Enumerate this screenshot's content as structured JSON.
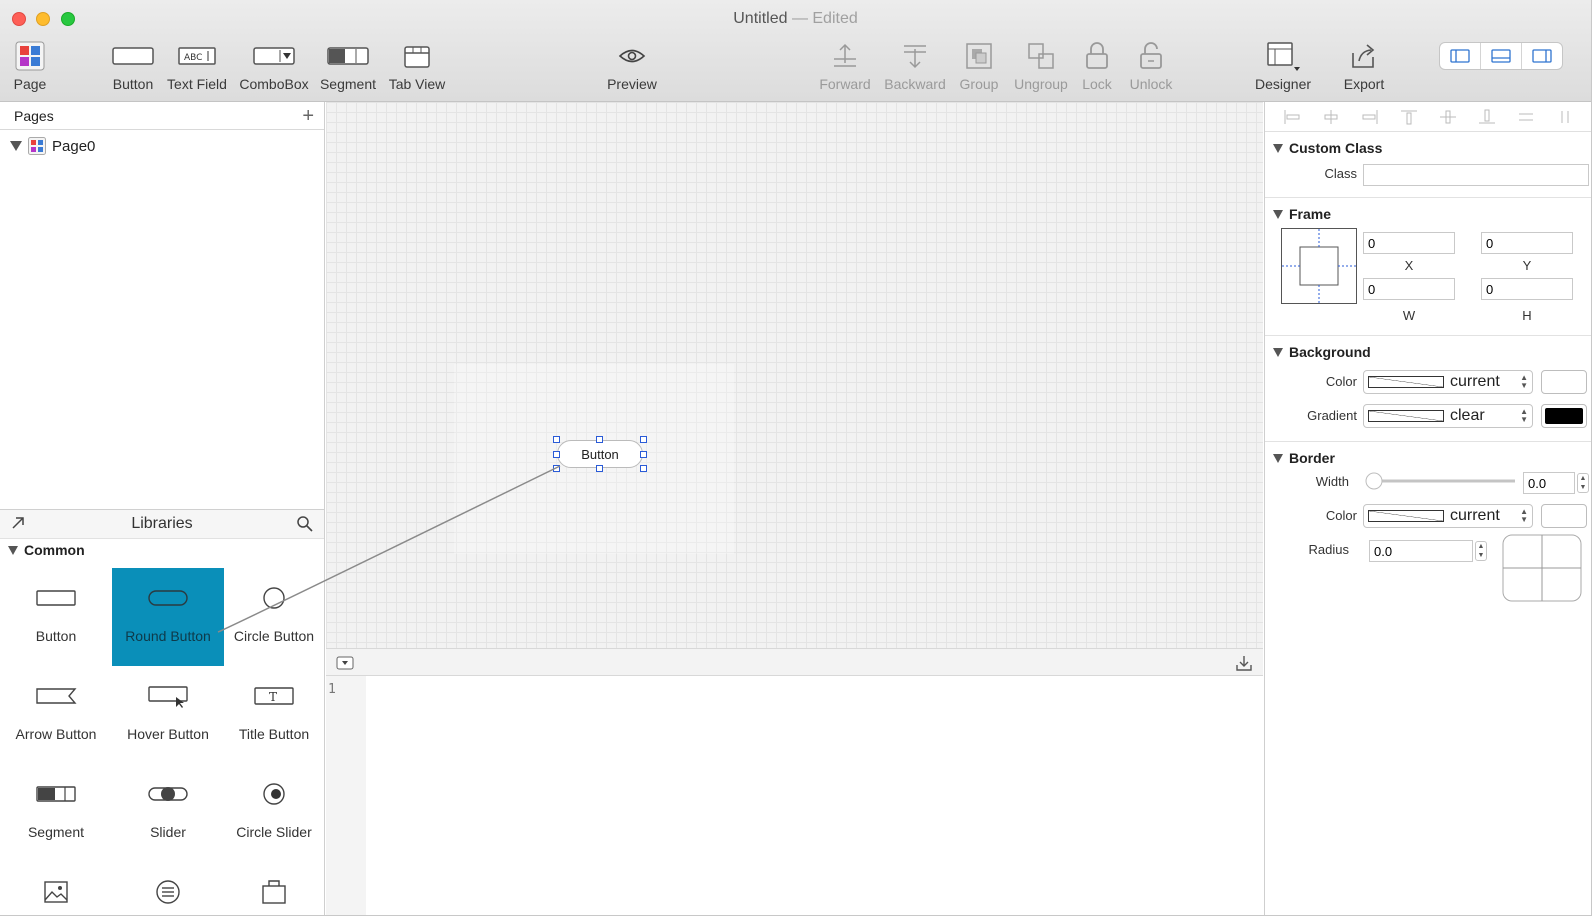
{
  "window": {
    "title": "Untitled",
    "title_suffix": "— Edited"
  },
  "toolbar": {
    "items": [
      {
        "label": "Page",
        "icon": "page-icon"
      },
      {
        "label": "Button",
        "icon": "button-icon"
      },
      {
        "label": "Text Field",
        "icon": "text-field-icon"
      },
      {
        "label": "ComboBox",
        "icon": "combobox-icon"
      },
      {
        "label": "Segment",
        "icon": "segment-icon"
      },
      {
        "label": "Tab View",
        "icon": "tab-view-icon"
      },
      {
        "label": "Preview",
        "icon": "eye-icon"
      },
      {
        "label": "Forward",
        "icon": "forward-icon",
        "disabled": true
      },
      {
        "label": "Backward",
        "icon": "backward-icon",
        "disabled": true
      },
      {
        "label": "Group",
        "icon": "group-icon",
        "disabled": true
      },
      {
        "label": "Ungroup",
        "icon": "ungroup-icon",
        "disabled": true
      },
      {
        "label": "Lock",
        "icon": "lock-icon",
        "disabled": true
      },
      {
        "label": "Unlock",
        "icon": "unlock-icon",
        "disabled": true
      },
      {
        "label": "Designer",
        "icon": "designer-icon"
      },
      {
        "label": "Export",
        "icon": "export-icon"
      }
    ]
  },
  "pages": {
    "header": "Pages",
    "items": [
      {
        "label": "Page0"
      }
    ]
  },
  "libraries": {
    "header": "Libraries",
    "group": "Common",
    "items": [
      {
        "label": "Button",
        "icon": "rect-button-icon"
      },
      {
        "label": "Round Button",
        "icon": "round-button-icon",
        "selected": true
      },
      {
        "label": "Circle Button",
        "icon": "circle-button-icon"
      },
      {
        "label": "Arrow Button",
        "icon": "arrow-button-icon"
      },
      {
        "label": "Hover Button",
        "icon": "hover-button-icon"
      },
      {
        "label": "Title Button",
        "icon": "title-button-icon"
      },
      {
        "label": "Segment",
        "icon": "segment-icon"
      },
      {
        "label": "Slider",
        "icon": "slider-icon"
      },
      {
        "label": "Circle Slider",
        "icon": "circle-slider-icon"
      },
      {
        "label": "",
        "icon": "image-icon"
      },
      {
        "label": "",
        "icon": "list-icon"
      },
      {
        "label": "",
        "icon": "box-icon"
      }
    ]
  },
  "canvas": {
    "button_label": "Button"
  },
  "code": {
    "line_number": "1"
  },
  "inspector": {
    "custom_class": {
      "header": "Custom Class",
      "class_label": "Class",
      "class_value": ""
    },
    "frame": {
      "header": "Frame",
      "x": "0",
      "y": "0",
      "w": "0",
      "h": "0",
      "x_label": "X",
      "y_label": "Y",
      "w_label": "W",
      "h_label": "H"
    },
    "background": {
      "header": "Background",
      "color_label": "Color",
      "color_value": "current",
      "gradient_label": "Gradient",
      "gradient_value": "clear",
      "color_well": "#ffffff",
      "gradient_well": "#000000"
    },
    "border": {
      "header": "Border",
      "width_label": "Width",
      "width_value": "0.0",
      "color_label": "Color",
      "color_value": "current",
      "radius_label": "Radius",
      "radius_value": "0.0",
      "color_well": "#ffffff"
    }
  },
  "colors": {
    "selection": "#0a8fb9",
    "handle": "#2a5bd7"
  }
}
